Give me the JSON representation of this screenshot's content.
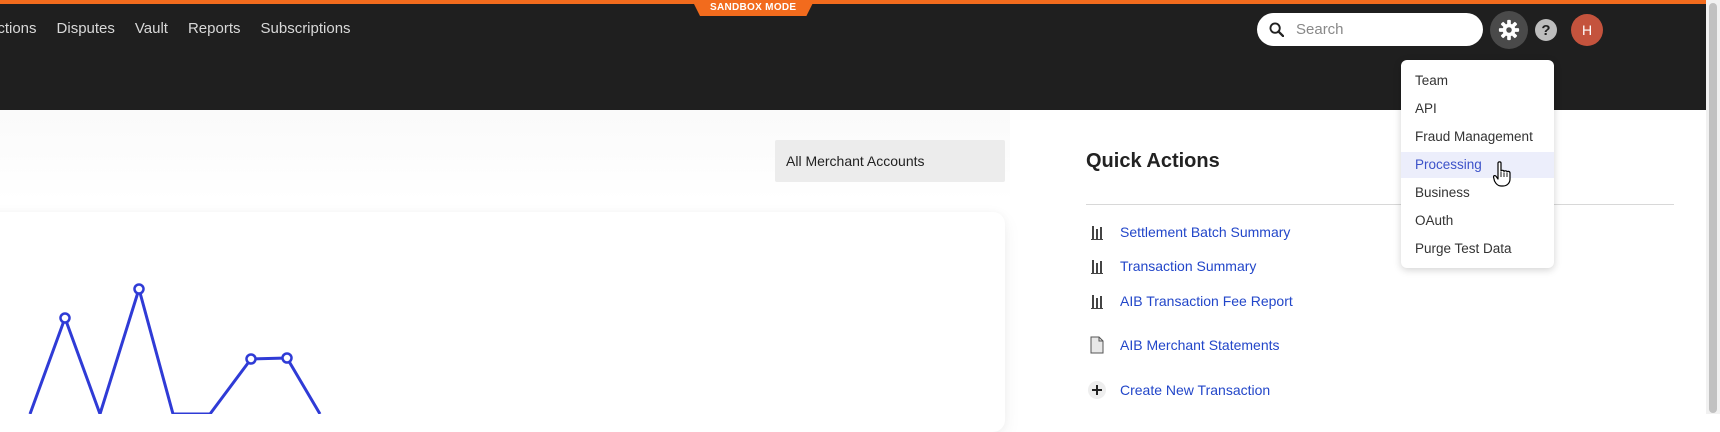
{
  "nav": {
    "items": [
      "actions",
      "Disputes",
      "Vault",
      "Reports",
      "Subscriptions"
    ]
  },
  "banner": {
    "sandbox_label": "SANDBOX MODE"
  },
  "search": {
    "placeholder": "Search",
    "value": ""
  },
  "header": {
    "help_label": "?",
    "avatar_initial": "H"
  },
  "merchant_select": {
    "selected": "All Merchant Accounts"
  },
  "quick_actions": {
    "title": "Quick Actions",
    "items": [
      {
        "label": "Settlement Batch Summary",
        "icon": "report-icon"
      },
      {
        "label": "Transaction Summary",
        "icon": "report-icon"
      },
      {
        "label": "AIB Transaction Fee Report",
        "icon": "report-icon"
      },
      {
        "label": "AIB Merchant Statements",
        "icon": "document-icon"
      },
      {
        "label": "Create New Transaction",
        "icon": "plus-icon"
      }
    ]
  },
  "settings_menu": {
    "items": [
      "Team",
      "API",
      "Fraud Management",
      "Processing",
      "Business",
      "OAuth",
      "Purge Test Data"
    ],
    "active": "Processing"
  },
  "chart": {
    "line_color": "#2f3bd6"
  },
  "colors": {
    "accent": "#f26b1d",
    "header_bg": "#1f1f1f",
    "link": "#2246c9"
  }
}
